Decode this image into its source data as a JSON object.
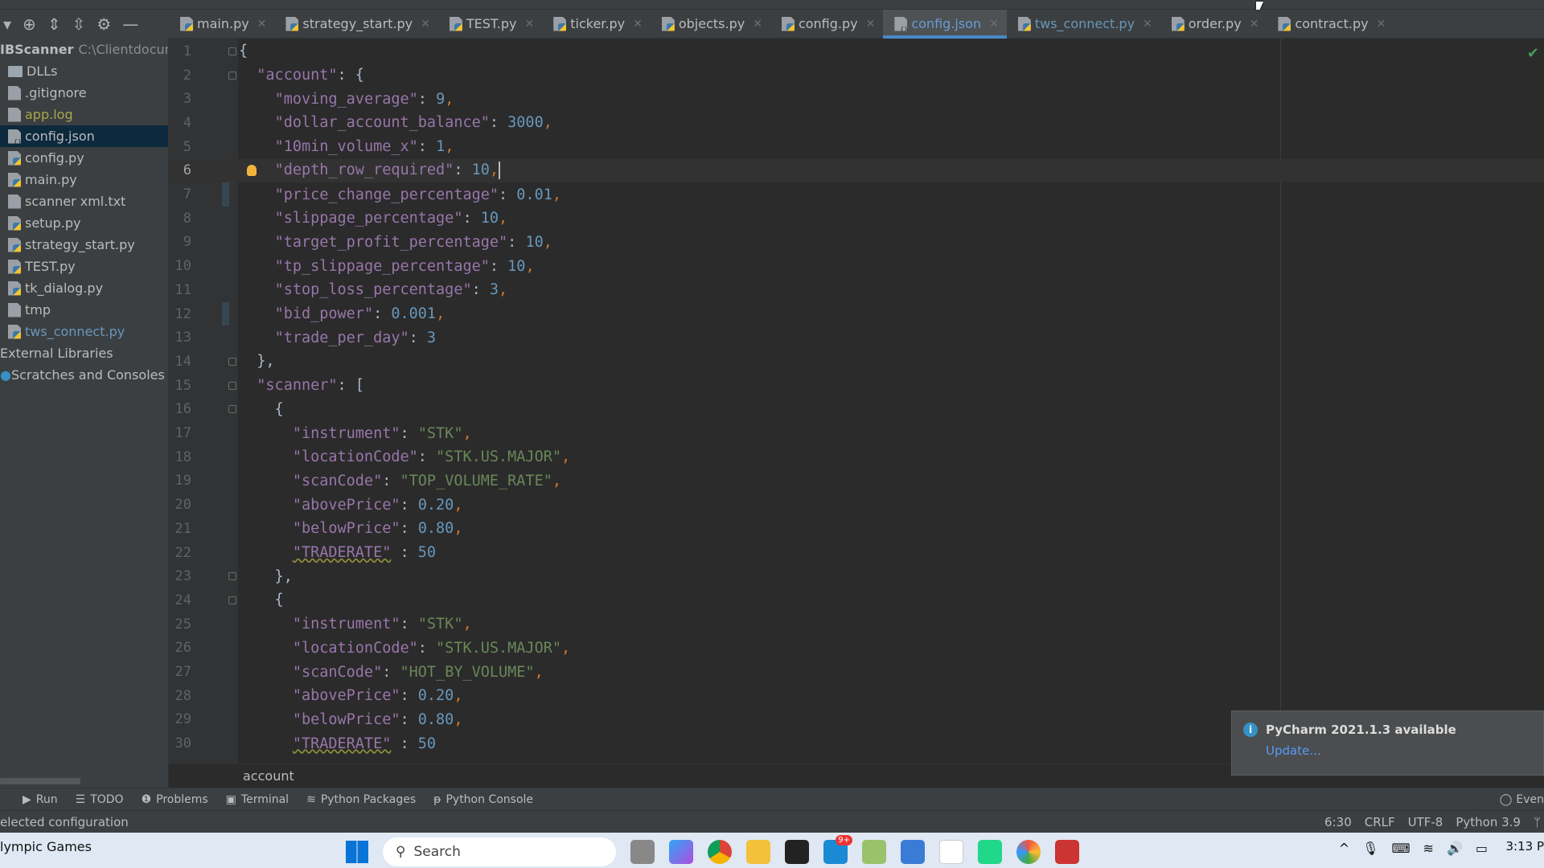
{
  "tabs": [
    {
      "label": "main.py",
      "type": "py"
    },
    {
      "label": "strategy_start.py",
      "type": "py"
    },
    {
      "label": "TEST.py",
      "type": "py"
    },
    {
      "label": "ticker.py",
      "type": "py"
    },
    {
      "label": "objects.py",
      "type": "py"
    },
    {
      "label": "config.py",
      "type": "py"
    },
    {
      "label": "config.json",
      "type": "json",
      "active": true
    },
    {
      "label": "tws_connect.py",
      "type": "py",
      "modified": true
    },
    {
      "label": "order.py",
      "type": "py"
    },
    {
      "label": "contract.py",
      "type": "py"
    }
  ],
  "project": {
    "name": "IBScanner",
    "path": "C:\\Clientdocume",
    "items": [
      {
        "label": "DLLs",
        "type": "folder"
      },
      {
        "label": ".gitignore",
        "type": "file"
      },
      {
        "label": "app.log",
        "type": "file",
        "state": "ignored"
      },
      {
        "label": "config.json",
        "type": "json",
        "selected": true
      },
      {
        "label": "config.py",
        "type": "py"
      },
      {
        "label": "main.py",
        "type": "py"
      },
      {
        "label": "scanner xml.txt",
        "type": "file"
      },
      {
        "label": "setup.py",
        "type": "py"
      },
      {
        "label": "strategy_start.py",
        "type": "py"
      },
      {
        "label": "TEST.py",
        "type": "py"
      },
      {
        "label": "tk_dialog.py",
        "type": "py"
      },
      {
        "label": "tmp",
        "type": "file"
      },
      {
        "label": "tws_connect.py",
        "type": "py",
        "state": "modified"
      }
    ],
    "extra": [
      "External Libraries",
      "Scratches and Consoles"
    ]
  },
  "editor": {
    "current_line": 6,
    "lines": [
      [
        [
          "b",
          "{"
        ]
      ],
      [
        [
          "b",
          "  "
        ],
        [
          "k",
          "\"account\""
        ],
        [
          "b",
          ": {"
        ]
      ],
      [
        [
          "b",
          "    "
        ],
        [
          "k",
          "\"moving_average\""
        ],
        [
          "b",
          ": "
        ],
        [
          "n",
          "9"
        ],
        [
          "p",
          ","
        ]
      ],
      [
        [
          "b",
          "    "
        ],
        [
          "k",
          "\"dollar_account_balance\""
        ],
        [
          "b",
          ": "
        ],
        [
          "n",
          "3000"
        ],
        [
          "p",
          ","
        ]
      ],
      [
        [
          "b",
          "    "
        ],
        [
          "k",
          "\"10min_volume_x\""
        ],
        [
          "b",
          ": "
        ],
        [
          "n",
          "1"
        ],
        [
          "p",
          ","
        ]
      ],
      [
        [
          "b",
          "    "
        ],
        [
          "k",
          "\"depth_row_required\""
        ],
        [
          "b",
          ": "
        ],
        [
          "n",
          "10"
        ],
        [
          "p",
          ","
        ]
      ],
      [
        [
          "b",
          "    "
        ],
        [
          "k",
          "\"price_change_percentage\""
        ],
        [
          "b",
          ": "
        ],
        [
          "n",
          "0.01"
        ],
        [
          "p",
          ","
        ]
      ],
      [
        [
          "b",
          "    "
        ],
        [
          "k",
          "\"slippage_percentage\""
        ],
        [
          "b",
          ": "
        ],
        [
          "n",
          "10"
        ],
        [
          "p",
          ","
        ]
      ],
      [
        [
          "b",
          "    "
        ],
        [
          "k",
          "\"target_profit_percentage\""
        ],
        [
          "b",
          ": "
        ],
        [
          "n",
          "10"
        ],
        [
          "p",
          ","
        ]
      ],
      [
        [
          "b",
          "    "
        ],
        [
          "k",
          "\"tp_slippage_percentage\""
        ],
        [
          "b",
          ": "
        ],
        [
          "n",
          "10"
        ],
        [
          "p",
          ","
        ]
      ],
      [
        [
          "b",
          "    "
        ],
        [
          "k",
          "\"stop_loss_percentage\""
        ],
        [
          "b",
          ": "
        ],
        [
          "n",
          "3"
        ],
        [
          "p",
          ","
        ]
      ],
      [
        [
          "b",
          "    "
        ],
        [
          "k",
          "\"bid_power\""
        ],
        [
          "b",
          ": "
        ],
        [
          "n",
          "0.001"
        ],
        [
          "p",
          ","
        ]
      ],
      [
        [
          "b",
          "    "
        ],
        [
          "k",
          "\"trade_per_day\""
        ],
        [
          "b",
          ": "
        ],
        [
          "n",
          "3"
        ]
      ],
      [
        [
          "b",
          "  },"
        ]
      ],
      [
        [
          "b",
          "  "
        ],
        [
          "k",
          "\"scanner\""
        ],
        [
          "b",
          ": ["
        ]
      ],
      [
        [
          "b",
          "    {"
        ]
      ],
      [
        [
          "b",
          "      "
        ],
        [
          "k",
          "\"instrument\""
        ],
        [
          "b",
          ": "
        ],
        [
          "s",
          "\"STK\""
        ],
        [
          "p",
          ","
        ]
      ],
      [
        [
          "b",
          "      "
        ],
        [
          "k",
          "\"locationCode\""
        ],
        [
          "b",
          ": "
        ],
        [
          "s",
          "\"STK.US.MAJOR\""
        ],
        [
          "p",
          ","
        ]
      ],
      [
        [
          "b",
          "      "
        ],
        [
          "k",
          "\"scanCode\""
        ],
        [
          "b",
          ": "
        ],
        [
          "s",
          "\"TOP_VOLUME_RATE\""
        ],
        [
          "p",
          ","
        ]
      ],
      [
        [
          "b",
          "      "
        ],
        [
          "k",
          "\"abovePrice\""
        ],
        [
          "b",
          ": "
        ],
        [
          "n",
          "0.20"
        ],
        [
          "p",
          ","
        ]
      ],
      [
        [
          "b",
          "      "
        ],
        [
          "k",
          "\"belowPrice\""
        ],
        [
          "b",
          ": "
        ],
        [
          "n",
          "0.80"
        ],
        [
          "p",
          ","
        ]
      ],
      [
        [
          "b",
          "      "
        ],
        [
          "kw",
          "\"TRADERATE\""
        ],
        [
          "b",
          " : "
        ],
        [
          "n",
          "50"
        ]
      ],
      [
        [
          "b",
          "    },"
        ]
      ],
      [
        [
          "b",
          "    {"
        ]
      ],
      [
        [
          "b",
          "      "
        ],
        [
          "k",
          "\"instrument\""
        ],
        [
          "b",
          ": "
        ],
        [
          "s",
          "\"STK\""
        ],
        [
          "p",
          ","
        ]
      ],
      [
        [
          "b",
          "      "
        ],
        [
          "k",
          "\"locationCode\""
        ],
        [
          "b",
          ": "
        ],
        [
          "s",
          "\"STK.US.MAJOR\""
        ],
        [
          "p",
          ","
        ]
      ],
      [
        [
          "b",
          "      "
        ],
        [
          "k",
          "\"scanCode\""
        ],
        [
          "b",
          ": "
        ],
        [
          "s",
          "\"HOT_BY_VOLUME\""
        ],
        [
          "p",
          ","
        ]
      ],
      [
        [
          "b",
          "      "
        ],
        [
          "k",
          "\"abovePrice\""
        ],
        [
          "b",
          ": "
        ],
        [
          "n",
          "0.20"
        ],
        [
          "p",
          ","
        ]
      ],
      [
        [
          "b",
          "      "
        ],
        [
          "k",
          "\"belowPrice\""
        ],
        [
          "b",
          ": "
        ],
        [
          "n",
          "0.80"
        ],
        [
          "p",
          ","
        ]
      ],
      [
        [
          "b",
          "      "
        ],
        [
          "kw",
          "\"TRADERATE\""
        ],
        [
          "b",
          " : "
        ],
        [
          "n",
          "50"
        ]
      ]
    ]
  },
  "breadcrumb": "account",
  "tool_windows": [
    "Run",
    "TODO",
    "Problems",
    "Terminal",
    "Python Packages",
    "Python Console"
  ],
  "event_log": "Even",
  "status": {
    "left": "elected configuration",
    "position": "6:30",
    "line_sep": "CRLF",
    "encoding": "UTF-8",
    "interpreter": "Python 3.9"
  },
  "notification": {
    "title": "PyCharm 2021.1.3 available",
    "action": "Update..."
  },
  "taskbar": {
    "news": "lympic Games",
    "search": "Search",
    "time": "3:13 P",
    "badge": "9+"
  }
}
